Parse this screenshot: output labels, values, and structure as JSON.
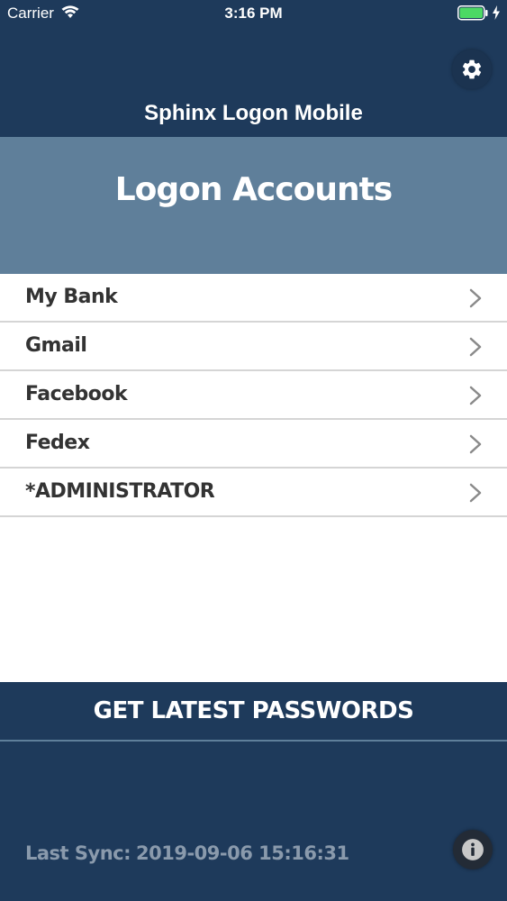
{
  "status_bar": {
    "carrier": "Carrier",
    "time": "3:16 PM",
    "battery_color": "#4cd964"
  },
  "header": {
    "title": "Sphinx Logon Mobile",
    "settings_icon": "gear-icon",
    "background": "#1e3a5b"
  },
  "banner": {
    "title": "Logon Accounts",
    "background": "#5f7f9a"
  },
  "accounts": [
    {
      "label": "My Bank"
    },
    {
      "label": "Gmail"
    },
    {
      "label": "Facebook"
    },
    {
      "label": "Fedex"
    },
    {
      "label": "*ADMINISTRATOR"
    }
  ],
  "footer": {
    "button_label": "GET LATEST PASSWORDS",
    "last_sync_label": "Last Sync:",
    "last_sync_value": "2019-09-06 15:16:31",
    "info_icon": "info-icon"
  }
}
